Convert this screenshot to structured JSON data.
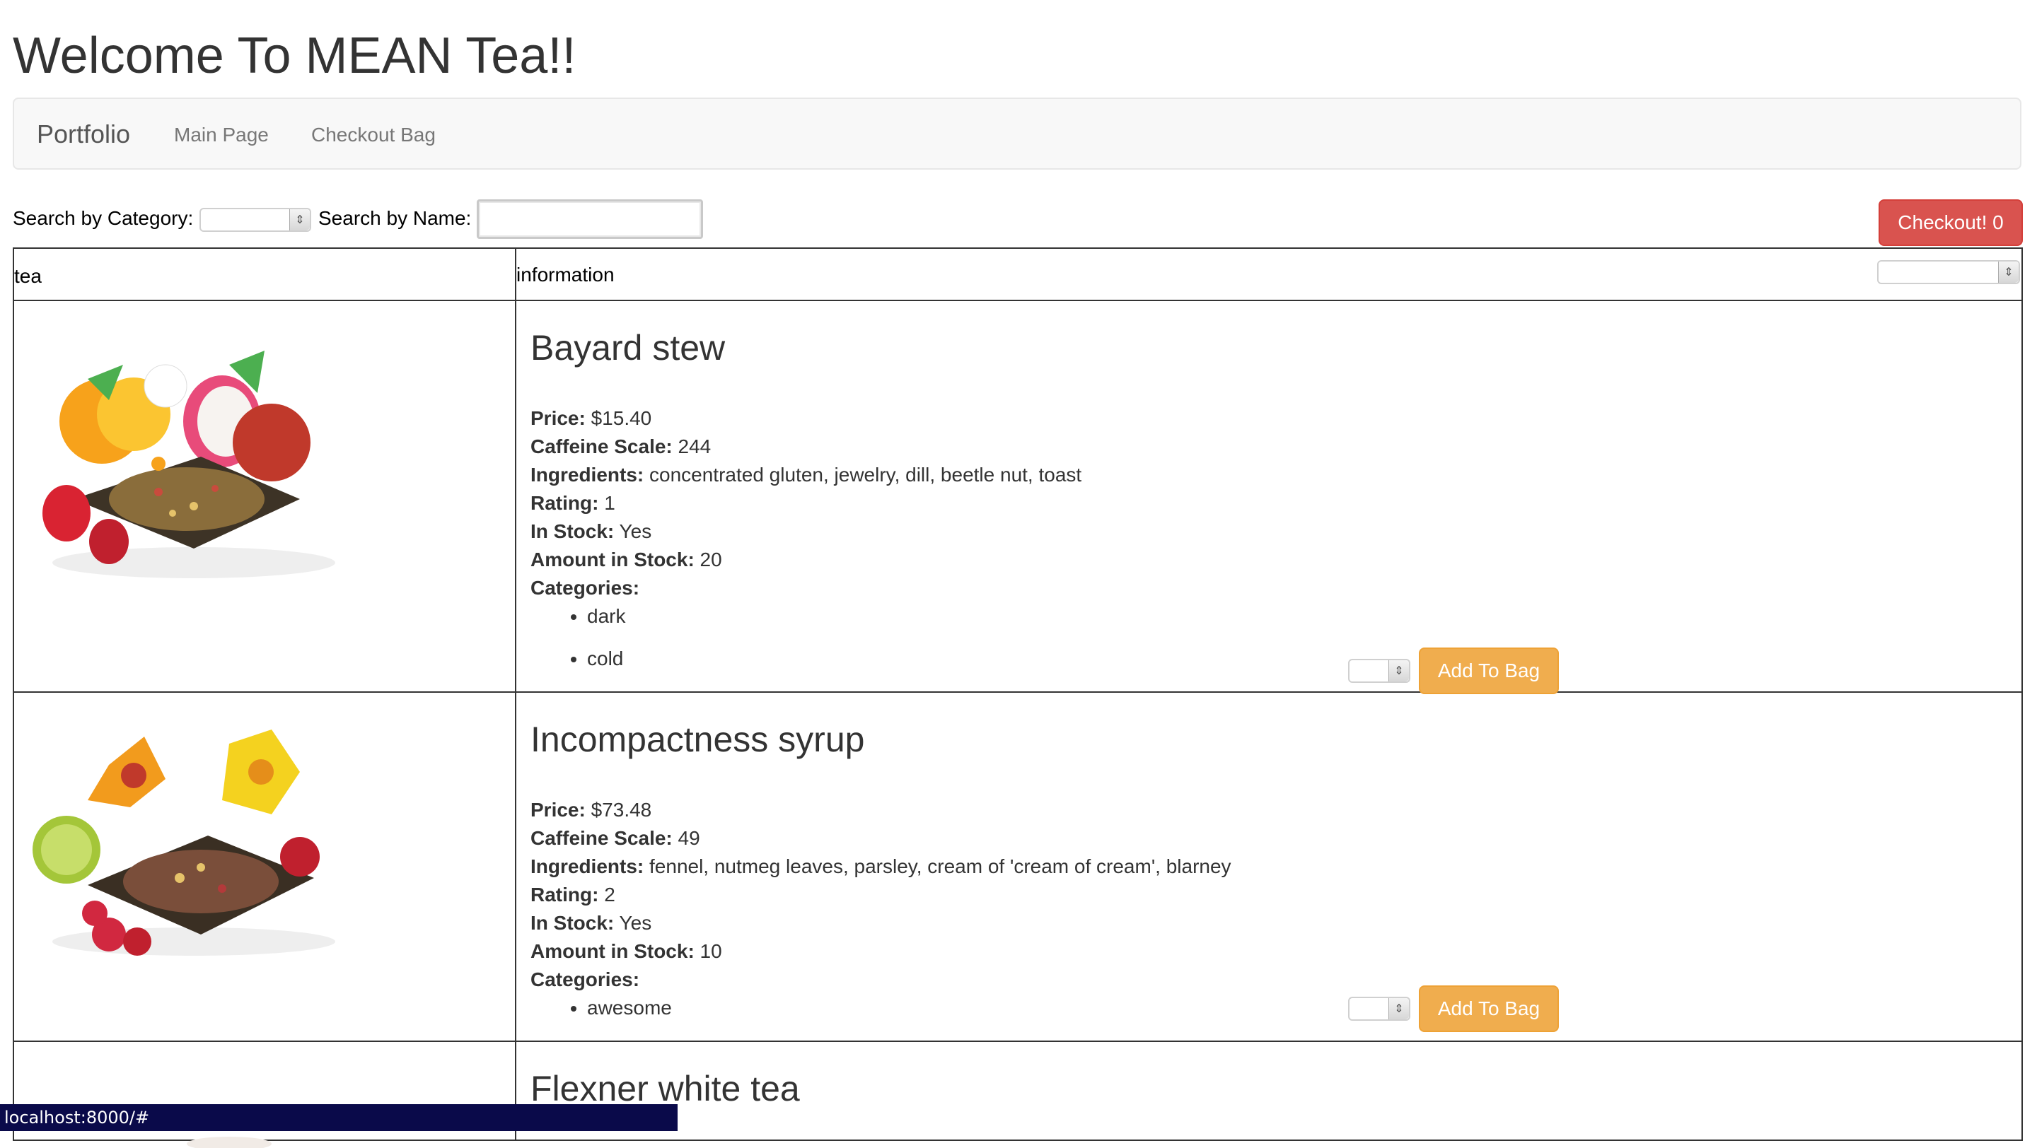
{
  "header": {
    "title": "Welcome To MEAN Tea!!"
  },
  "navbar": {
    "brand": "Portfolio",
    "links": [
      "Main Page",
      "Checkout Bag"
    ]
  },
  "search": {
    "category_label": "Search by Category:",
    "name_label": "Search by Name:",
    "name_value": ""
  },
  "checkout": {
    "label": "Checkout! 0"
  },
  "table": {
    "headers": {
      "tea": "tea",
      "information": "information"
    }
  },
  "labels": {
    "price": "Price:",
    "caffeine": "Caffeine Scale:",
    "ingredients": "Ingredients:",
    "rating": "Rating:",
    "in_stock": "In Stock:",
    "amount": "Amount in Stock:",
    "categories": "Categories:",
    "add_to_bag": "Add To Bag"
  },
  "teas": [
    {
      "name": "Bayard stew",
      "price": "$15.40",
      "caffeine": "244",
      "ingredients": "concentrated gluten, jewelry, dill, beetle nut, toast",
      "rating": "1",
      "in_stock": "Yes",
      "amount": "20",
      "categories": [
        "dark",
        "cold"
      ]
    },
    {
      "name": "Incompactness syrup",
      "price": "$73.48",
      "caffeine": "49",
      "ingredients": "fennel, nutmeg leaves, parsley, cream of 'cream of cream', blarney",
      "rating": "2",
      "in_stock": "Yes",
      "amount": "10",
      "categories": [
        "awesome"
      ]
    },
    {
      "name": "Flexner white tea"
    }
  ],
  "status_bar": {
    "url": "localhost:8000/#"
  },
  "colors": {
    "checkout_button": "#d9534f",
    "add_button": "#f0ad4e",
    "navbar_bg": "#f8f8f8",
    "status_bar_bg": "#0a0a4a"
  },
  "icons": {
    "select_arrows": "updown-chevron-icon",
    "tea_image_1": "fruit-tea-photo",
    "tea_image_2": "hibiscus-tea-photo"
  }
}
